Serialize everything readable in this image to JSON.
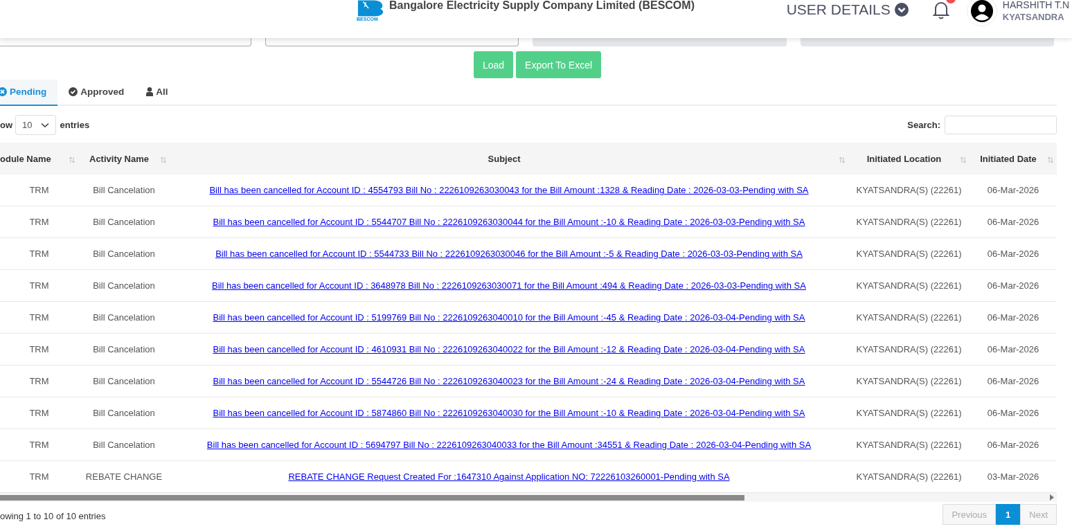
{
  "header": {
    "logo_text": "BESCOM",
    "title": "Bangalore Electricity Supply Company Limited (BESCOM)",
    "user_details": "USER DETAILS",
    "user": {
      "name": "HARSHITH T.N",
      "location": "KYATSANDRA"
    }
  },
  "filters": [
    {
      "disabled": false
    },
    {
      "disabled": false
    },
    {
      "disabled": true
    },
    {
      "disabled": true
    }
  ],
  "buttons": [
    "Load",
    "Export To Excel"
  ],
  "tabs": [
    {
      "label": "Pending",
      "kind": "pending",
      "selected": true
    },
    {
      "label": "Approved",
      "kind": "approved",
      "selected": false
    },
    {
      "label": "All",
      "kind": "all",
      "selected": false
    }
  ],
  "length_control": {
    "label_before": "ow",
    "value": "10",
    "label_after": "entries"
  },
  "search": {
    "label": "Search:"
  },
  "table": {
    "columns": [
      {
        "label": "odule Name"
      },
      {
        "label": "Activity Name"
      },
      {
        "label": "Subject"
      },
      {
        "label": "Initiated Location"
      },
      {
        "label": "Initiated Date"
      }
    ],
    "rows": [
      {
        "module": "TRM",
        "activity": "Bill Cancelation",
        "subject": "Bill has been cancelled for Account ID : 4554793 Bill No : 2226109263030043 for the Bill Amount :1328 & Reading Date : 2026-03-03-Pending with SA",
        "location": "KYATSANDRA(S) (22261)",
        "date": "06-Mar-2026"
      },
      {
        "module": "TRM",
        "activity": "Bill Cancelation",
        "subject": "Bill has been cancelled for Account ID : 5544707 Bill No : 2226109263030044 for the Bill Amount :-10 & Reading Date : 2026-03-03-Pending with SA",
        "location": "KYATSANDRA(S) (22261)",
        "date": "06-Mar-2026"
      },
      {
        "module": "TRM",
        "activity": "Bill Cancelation",
        "subject": "Bill has been cancelled for Account ID : 5544733 Bill No : 2226109263030046 for the Bill Amount :-5 & Reading Date : 2026-03-03-Pending with SA",
        "location": "KYATSANDRA(S) (22261)",
        "date": "06-Mar-2026"
      },
      {
        "module": "TRM",
        "activity": "Bill Cancelation",
        "subject": "Bill has been cancelled for Account ID : 3648978 Bill No : 2226109263030071 for the Bill Amount :494 & Reading Date : 2026-03-03-Pending with SA",
        "location": "KYATSANDRA(S) (22261)",
        "date": "06-Mar-2026"
      },
      {
        "module": "TRM",
        "activity": "Bill Cancelation",
        "subject": "Bill has been cancelled for Account ID : 5199769 Bill No : 2226109263040010 for the Bill Amount :-45 & Reading Date : 2026-03-04-Pending with SA",
        "location": "KYATSANDRA(S) (22261)",
        "date": "06-Mar-2026"
      },
      {
        "module": "TRM",
        "activity": "Bill Cancelation",
        "subject": "Bill has been cancelled for Account ID : 4610931 Bill No : 2226109263040022 for the Bill Amount :-12 & Reading Date : 2026-03-04-Pending with SA",
        "location": "KYATSANDRA(S) (22261)",
        "date": "06-Mar-2026"
      },
      {
        "module": "TRM",
        "activity": "Bill Cancelation",
        "subject": "Bill has been cancelled for Account ID : 5544726 Bill No : 2226109263040023 for the Bill Amount :-24 & Reading Date : 2026-03-04-Pending with SA",
        "location": "KYATSANDRA(S) (22261)",
        "date": "06-Mar-2026"
      },
      {
        "module": "TRM",
        "activity": "Bill Cancelation",
        "subject": "Bill has been cancelled for Account ID : 5874860 Bill No : 2226109263040030 for the Bill Amount :-10 & Reading Date : 2026-03-04-Pending with SA",
        "location": "KYATSANDRA(S) (22261)",
        "date": "06-Mar-2026"
      },
      {
        "module": "TRM",
        "activity": "Bill Cancelation",
        "subject": "Bill has been cancelled for Account ID : 5694797 Bill No : 2226109263040033 for the Bill Amount :34551 & Reading Date : 2026-03-04-Pending with SA",
        "location": "KYATSANDRA(S) (22261)",
        "date": "06-Mar-2026"
      },
      {
        "module": "TRM",
        "activity": "REBATE CHANGE",
        "subject": "REBATE CHANGE Request Created For :1647310 Against Application NO: 72226103260001-Pending with SA",
        "location": "KYATSANDRA(S) (22261)",
        "date": "03-Mar-2026"
      }
    ]
  },
  "info": "owing 1 to 10 of 10 entries",
  "pagination": [
    {
      "label": "Previous",
      "kind": "nav",
      "selected": false,
      "disabled": true
    },
    {
      "label": "1",
      "kind": "page",
      "selected": true,
      "disabled": false
    },
    {
      "label": "Next",
      "kind": "nav",
      "selected": false,
      "disabled": true
    }
  ]
}
